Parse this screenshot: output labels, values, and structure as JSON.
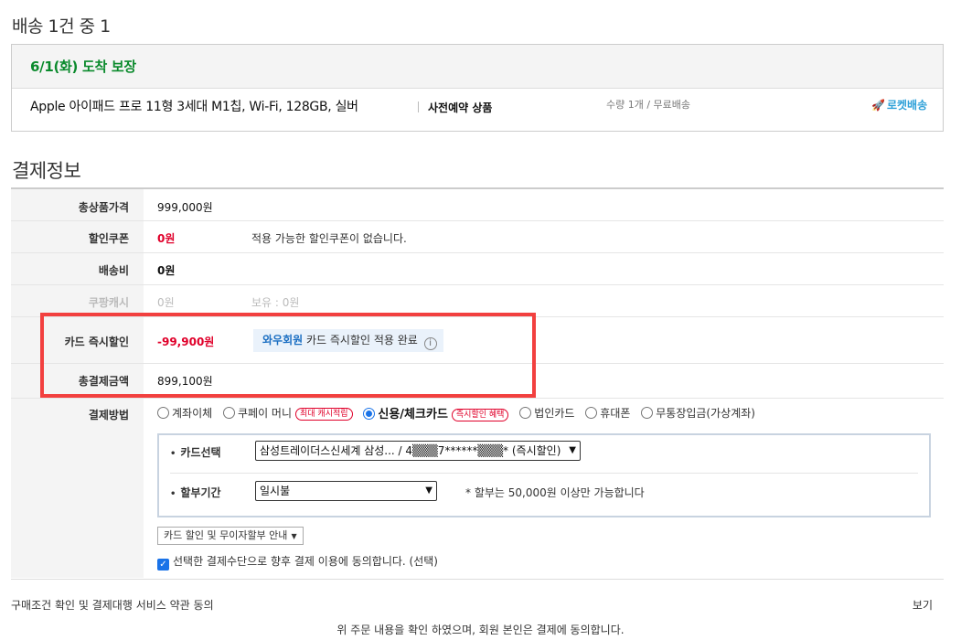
{
  "shipping": {
    "header": "배송 1건 중 1",
    "date_guarantee": "6/1(화) 도착 보장",
    "product_name": "Apple 아이패드 프로 11형 3세대 M1칩, Wi-Fi, 128GB, 실버",
    "preorder": "사전예약 상품",
    "qty": "수량 1개 / 무료배송",
    "rocket": "로켓배송",
    "rocket_icon": "rocket-icon"
  },
  "payment": {
    "title": "결제정보",
    "rows": {
      "total_price": {
        "label": "총상품가격",
        "value": "999,000원"
      },
      "coupon": {
        "label": "할인쿠폰",
        "value": "0원",
        "note": "적용 가능한 할인쿠폰이 없습니다."
      },
      "shipping_fee": {
        "label": "배송비",
        "value": "0원"
      },
      "coupang_cash": {
        "label": "쿠팡캐시",
        "value": "0원",
        "note": "보유 : 0원"
      },
      "card_discount": {
        "label": "카드 즉시할인",
        "value": "-99,900원",
        "wow": "와우회원",
        "note": "카드 즉시할인 적용 완료"
      },
      "final_amount": {
        "label": "총결제금액",
        "value": "899,100원"
      },
      "method": {
        "label": "결제방법"
      }
    },
    "methods": [
      {
        "label": "계좌이체",
        "selected": false
      },
      {
        "label": "쿠페이 머니",
        "badge": "최대 캐시적립",
        "selected": false
      },
      {
        "label": "신용/체크카드",
        "badge": "즉시할인 혜택",
        "selected": true
      },
      {
        "label": "법인카드",
        "selected": false
      },
      {
        "label": "휴대폰",
        "selected": false
      },
      {
        "label": "무통장입금(가상계좌)",
        "selected": false
      }
    ],
    "card": {
      "select_label": "카드선택",
      "select_value": "삼성트레이더스신세계 삼성... / 4▒▒▒7******▒▒▒* (즉시할인)",
      "installment_label": "할부기간",
      "installment_value": "일시불",
      "installment_note": "* 할부는 50,000원 이상만 가능합니다"
    },
    "guide_button": "카드 할인 및 무이자할부 안내",
    "agree_text": "선택한 결제수단으로 향후 결제 이용에 동의합니다. (선택)"
  },
  "terms": {
    "label": "구매조건 확인 및 결제대행 서비스 약관 동의",
    "view": "보기",
    "consent": "위 주문 내용을 확인 하였으며, 회원 본인은 결제에 동의합니다."
  },
  "colors": {
    "accent_red": "#e0002a",
    "highlight_border": "#f2403f",
    "date_green": "#0a8a2c",
    "rocket_blue": "#2da0d8",
    "radio_blue": "#1a73e8"
  }
}
